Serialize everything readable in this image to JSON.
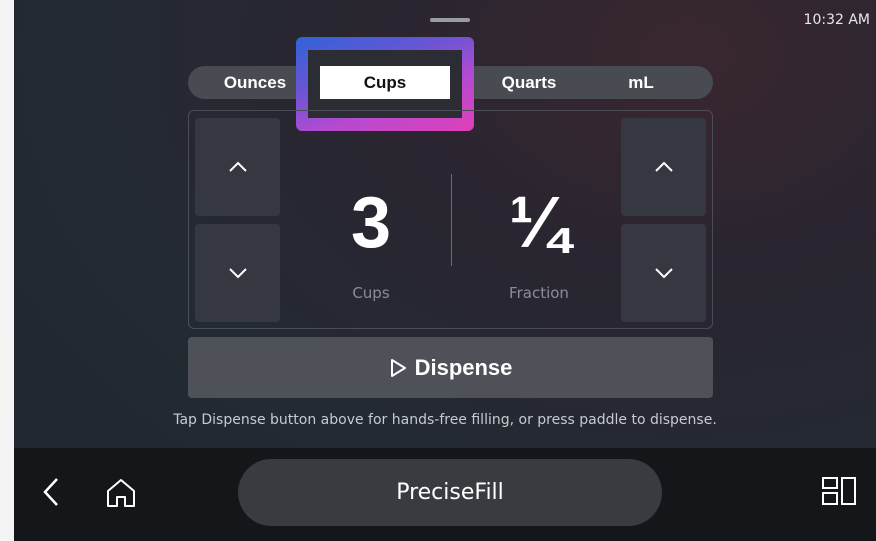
{
  "status": {
    "time": "10:32 AM"
  },
  "units": {
    "tabs": [
      {
        "label": "Ounces"
      },
      {
        "label": "Cups"
      },
      {
        "label": "Quarts"
      },
      {
        "label": "mL"
      }
    ],
    "selected": "Cups"
  },
  "amount": {
    "whole": "3",
    "whole_label": "Cups",
    "fraction": "¼",
    "fraction_label": "Fraction"
  },
  "dispense": {
    "label": "Dispense"
  },
  "hint": "Tap Dispense button above for hands-free filling, or press paddle to dispense.",
  "bottom_bar": {
    "title": "PreciseFill"
  },
  "icons": {
    "back": "chevron-left-icon",
    "home": "home-icon",
    "apps": "app-grid-icon",
    "up": "chevron-up-icon",
    "down": "chevron-down-icon",
    "play": "play-outline-icon"
  },
  "colors": {
    "highlight_gradient_start": "#2f63d8",
    "highlight_gradient_end": "#e040b8"
  }
}
